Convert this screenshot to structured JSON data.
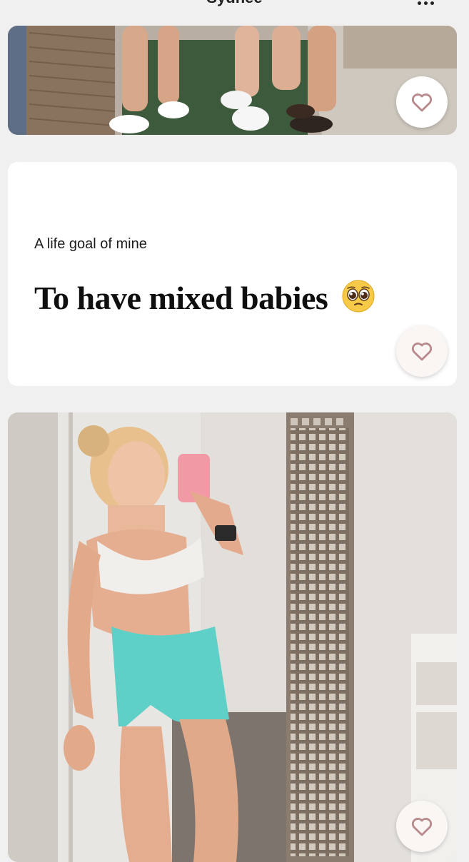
{
  "header": {
    "title": "Sydnee",
    "menu_icon": "more-horizontal-icon"
  },
  "prompt": {
    "label": "A life goal of mine",
    "answer": "To have mixed babies",
    "emoji": "pleading-face-emoji"
  },
  "like_icon": "heart-outline-icon",
  "colors": {
    "background": "#f1f0f0",
    "card": "#ffffff",
    "heart_stroke": "#b98a8c"
  }
}
